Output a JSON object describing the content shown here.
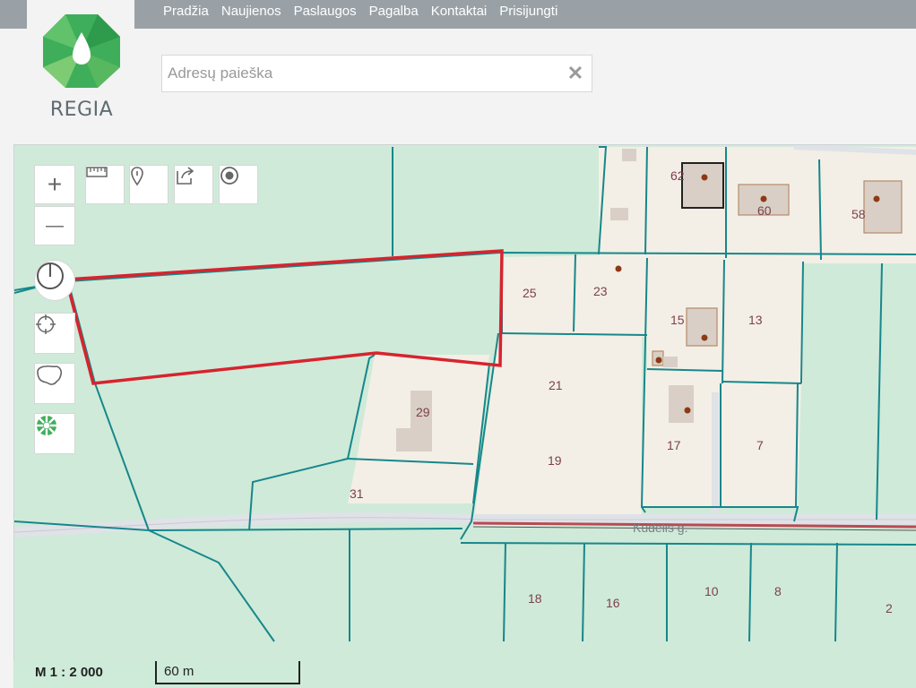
{
  "nav": {
    "items": [
      "Pradžia",
      "Naujienos",
      "Paslaugos",
      "Pagalba",
      "Kontaktai",
      "Prisijungti"
    ]
  },
  "logo": {
    "text": "REGIA"
  },
  "search": {
    "placeholder": "Adresų paieška",
    "value": "",
    "clear_glyph": "✕"
  },
  "map": {
    "parcel_numbers": [
      "62",
      "60",
      "58",
      "25",
      "23",
      "15",
      "13",
      "21",
      "29",
      "17",
      "7",
      "19",
      "31",
      "18",
      "16",
      "10",
      "8",
      "2"
    ],
    "street_name": "Kudelis g.",
    "scale_ratio": "M 1 : 2 000",
    "scale_distance": "60 m"
  },
  "controls": {
    "zoom_in": "+",
    "zoom_out": "—"
  },
  "colors": {
    "land_green": "#cfead9",
    "parcel_beige": "#f3efe6",
    "parcel_line": "#17878a",
    "selection": "#d8232e",
    "building": "#d9cfc6",
    "building_outline": "#b78a6a",
    "road": "#dfe2e6"
  }
}
